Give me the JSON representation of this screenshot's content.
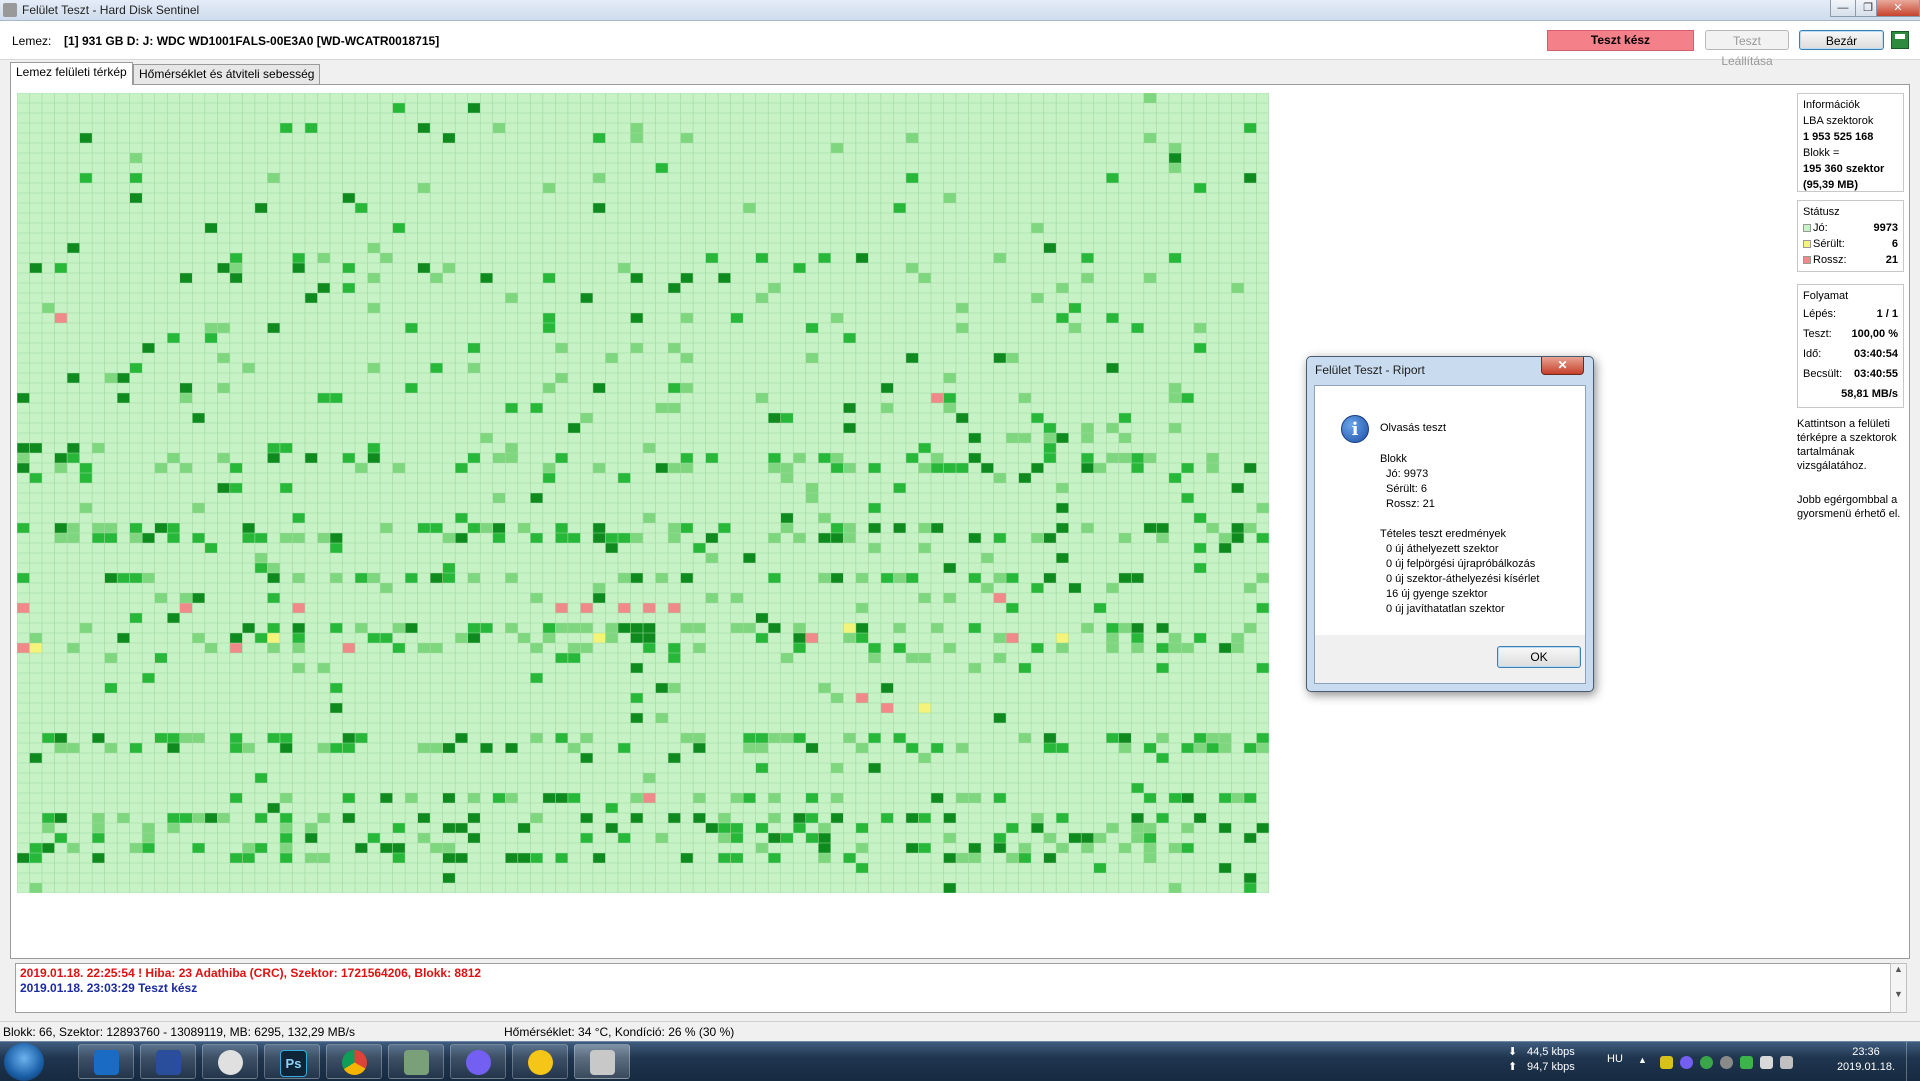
{
  "window": {
    "title": "Felület Teszt - Hard Disk Sentinel",
    "min_glyph": "—",
    "max_glyph": "❐",
    "close_glyph": "✕"
  },
  "toolbar": {
    "disk_label": "Lemez:",
    "disk_name": "[1] 931 GB D: J: WDC WD1001FALS-00E3A0 [WD-WCATR0018715]",
    "status": "Teszt kész",
    "stop_button": "Teszt Leállítása",
    "close_button": "Bezár"
  },
  "tabs": [
    "Lemez felületi térkép",
    "Hőmérséklet és átviteli sebesség"
  ],
  "colors": {
    "block_ok": "#c6f2c6",
    "block_ok_dark": "#0e8a1e",
    "block_ok_medium": "#27b83a",
    "block_ok_light": "#7ed67e",
    "block_damaged": "#f4f47a",
    "block_bad": "#f08a8a",
    "grid_line": "#9fd99f",
    "status_red": "#f4808a"
  },
  "info": {
    "heading": "Információk",
    "lba_label": "LBA szektorok",
    "lba_value": "1 953 525 168",
    "block_label": "Blokk =",
    "block_sectors": "195 360 szektor",
    "block_size": "(95,39 MB)"
  },
  "status": {
    "heading": "Státusz",
    "ok_label": "Jó:",
    "ok_value": "9973",
    "damaged_label": "Sérült:",
    "damaged_value": "6",
    "bad_label": "Rossz:",
    "bad_value": "21"
  },
  "progress": {
    "heading": "Folyamat",
    "step_label": "Lépés:",
    "step_value": "1 / 1",
    "test_label": "Teszt:",
    "test_value": "100,00 %",
    "time_label": "Idő:",
    "time_value": "03:40:54",
    "est_label": "Becsült:",
    "est_value": "03:40:55",
    "speed": "58,81 MB/s"
  },
  "hints": {
    "click": "Kattintson a felületi térképre a szektorok tartalmának vizsgálatához.",
    "right_click": "Jobb egérgombbal a gyorsmenü érhető el."
  },
  "log": [
    {
      "text": "2019.01.18.  22:25:54 ! Hiba: 23 Adathiba (CRC), Szektor: 1721564206, Blokk: 8812",
      "color": "#e01010"
    },
    {
      "text": "2019.01.18.  23:03:29   Teszt kész",
      "color": "#1a2aa0"
    }
  ],
  "log_scroll": {
    "up": "▲",
    "down": "▼"
  },
  "statusbar": {
    "left": "Blokk: 66, Szektor: 12893760 - 13089119, MB: 6295, 132,29 MB/s",
    "middle": "Hőmérséklet: 34  °C,  Kondíció: 26 % (30 %)"
  },
  "dialog": {
    "title": "Felület Teszt - Riport",
    "close_glyph": "✕",
    "icon_glyph": "i",
    "heading": "Olvasás teszt",
    "block_heading": "Blokk",
    "ok_line": "Jó: 9973",
    "damaged_line": "Sérült: 6",
    "bad_line": "Rossz: 21",
    "results_heading": "Tételes teszt eredmények",
    "results": [
      "0 új áthelyezett szektor",
      "0 új felpörgési újrapróbálkozás",
      "0 új szektor-áthelyezési kísérlet",
      "16 új gyenge szektor",
      "0 új javíthatatlan szektor"
    ],
    "ok_button": "OK"
  },
  "taskbar": {
    "ps_label": "Ps",
    "download": "44,5 kbps",
    "upload": "94,7 kbps",
    "down_arrow": "⬇",
    "up_arrow": "⬆",
    "language": "HU",
    "tray_arrow": "▲",
    "time": "23:36",
    "date": "2019.01.18."
  }
}
